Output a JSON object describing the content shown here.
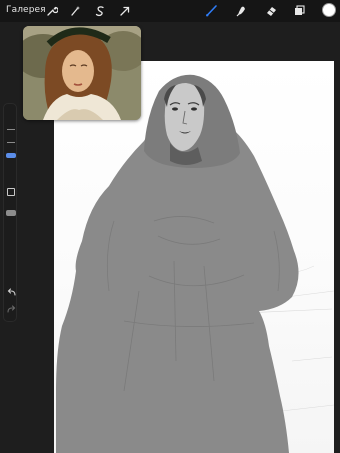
{
  "topbar": {
    "gallery_label": "Галерея",
    "left_tools": [
      "wrench-icon",
      "magic-wand-icon",
      "selection-s-icon",
      "transform-arrow-icon"
    ],
    "right_tools": [
      "brush-icon",
      "smudge-icon",
      "eraser-icon",
      "layers-icon"
    ],
    "active_tool": "brush-icon",
    "active_tool_color": "#2f7cf6",
    "current_color": "#ffffff"
  },
  "sidebar": {
    "brush_size_level": 0.28,
    "opacity_level": 0.3,
    "accent_color": "#5b8de8",
    "undo_icon": "undo-icon",
    "redo_icon": "redo-icon"
  },
  "reference": {
    "icon": "reference-portrait-image"
  },
  "canvas": {
    "background": "#ffffff",
    "figure_color": "#8a8a8a"
  }
}
